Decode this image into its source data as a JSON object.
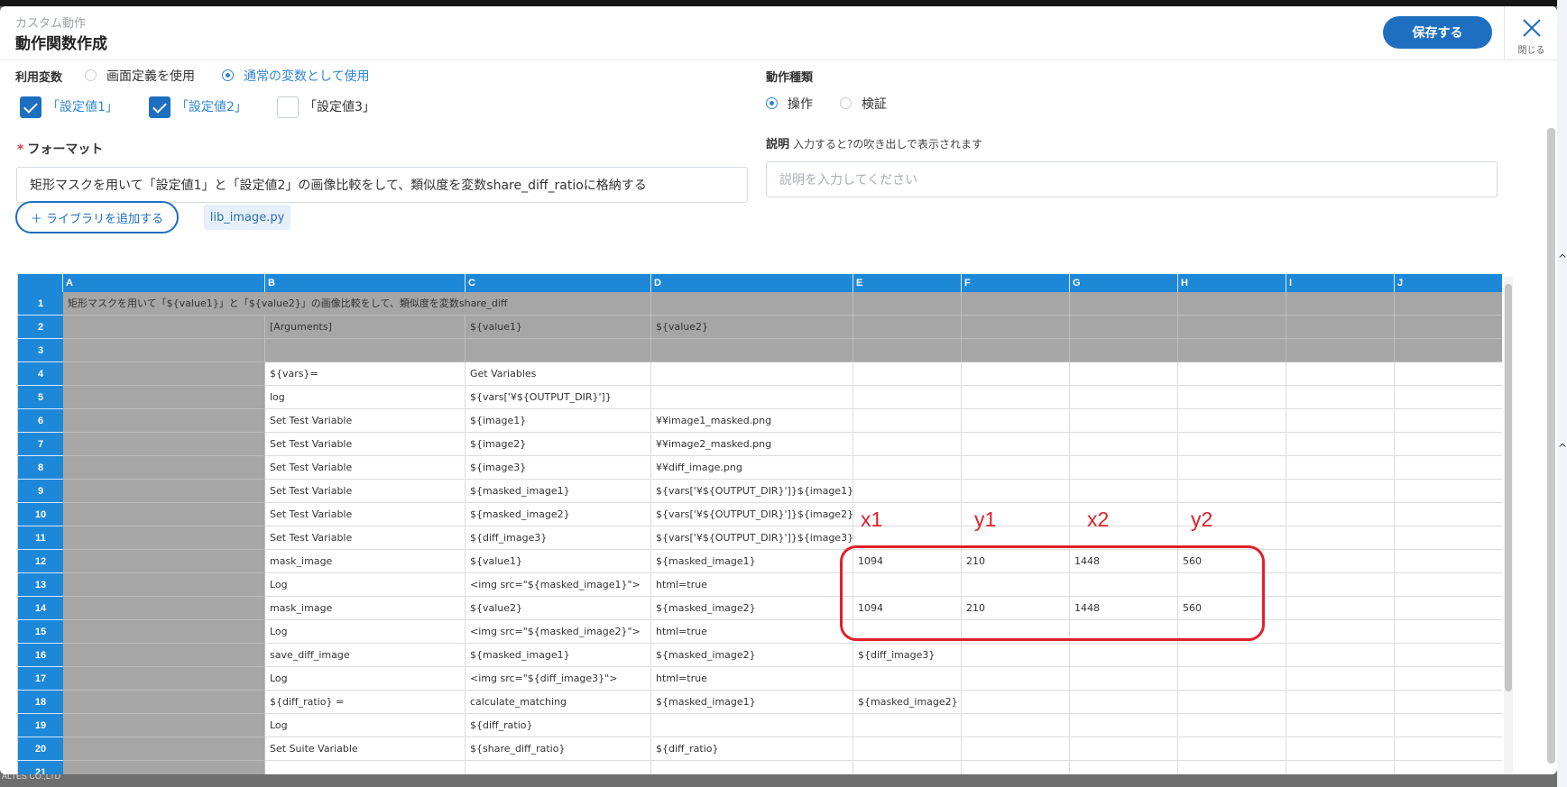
{
  "header": {
    "subtitle": "カスタム動作",
    "title": "動作関数作成",
    "save_label": "保存する",
    "close_label": "閉じる"
  },
  "variables": {
    "label": "利用変数",
    "radio_screen": "画面定義を使用",
    "radio_normal": "通常の変数として使用",
    "checkboxes": [
      "「設定値1」",
      "「設定値2」",
      "「設定値3」"
    ]
  },
  "action_type": {
    "label": "動作種類",
    "op": "操作",
    "verify": "検証"
  },
  "format": {
    "label": "フォーマット",
    "value": "矩形マスクを用いて「設定値1」と「設定値2」の画像比較をして、類似度を変数share_diff_ratioに格納する"
  },
  "description": {
    "label": "説明",
    "hint": "入力すると?の吹き出しで表示されます",
    "placeholder": "説明を入力してください"
  },
  "library": {
    "add_label": "＋ ライブラリを追加する",
    "chip": "lib_image.py"
  },
  "sheet": {
    "columns": [
      "A",
      "B",
      "C",
      "D",
      "E",
      "F",
      "G",
      "H",
      "I",
      "J"
    ],
    "rows": [
      [
        "1",
        "矩形マスクを用いて「${value1}」と「${value2}」の画像比較をして、類似度を変数share_diff",
        "",
        "",
        "",
        "",
        "",
        "",
        "",
        "",
        ""
      ],
      [
        "2",
        "",
        "[Arguments]",
        "${value1}",
        "${value2}",
        "",
        "",
        "",
        "",
        "",
        ""
      ],
      [
        "3",
        "",
        "",
        "",
        "",
        "",
        "",
        "",
        "",
        "",
        ""
      ],
      [
        "4",
        "",
        "${vars}=",
        "Get Variables",
        "",
        "",
        "",
        "",
        "",
        "",
        ""
      ],
      [
        "5",
        "",
        "log",
        "${vars['¥${OUTPUT_DIR}']}",
        "",
        "",
        "",
        "",
        "",
        "",
        ""
      ],
      [
        "6",
        "",
        "Set Test Variable",
        "${image1}",
        "¥¥image1_masked.png",
        "",
        "",
        "",
        "",
        "",
        ""
      ],
      [
        "7",
        "",
        "Set Test Variable",
        "${image2}",
        "¥¥image2_masked.png",
        "",
        "",
        "",
        "",
        "",
        ""
      ],
      [
        "8",
        "",
        "Set Test Variable",
        "${image3}",
        "¥¥diff_image.png",
        "",
        "",
        "",
        "",
        "",
        ""
      ],
      [
        "9",
        "",
        "Set Test Variable",
        "${masked_image1}",
        "${vars['¥${OUTPUT_DIR}']}${image1}",
        "",
        "",
        "",
        "",
        "",
        ""
      ],
      [
        "10",
        "",
        "Set Test Variable",
        "${masked_image2}",
        "${vars['¥${OUTPUT_DIR}']}${image2}",
        "",
        "",
        "",
        "",
        "",
        ""
      ],
      [
        "11",
        "",
        "Set Test Variable",
        "${diff_image3}",
        "${vars['¥${OUTPUT_DIR}']}${image3}",
        "",
        "",
        "",
        "",
        "",
        ""
      ],
      [
        "12",
        "",
        "mask_image",
        "${value1}",
        "${masked_image1}",
        "1094",
        "210",
        "1448",
        "560",
        "",
        ""
      ],
      [
        "13",
        "",
        "Log",
        "<img src=\"${masked_image1}\">",
        "html=true",
        "",
        "",
        "",
        "",
        "",
        ""
      ],
      [
        "14",
        "",
        "mask_image",
        "${value2}",
        "${masked_image2}",
        "1094",
        "210",
        "1448",
        "560",
        "",
        ""
      ],
      [
        "15",
        "",
        "Log",
        "<img src=\"${masked_image2}\">",
        "html=true",
        "",
        "",
        "",
        "",
        "",
        ""
      ],
      [
        "16",
        "",
        "save_diff_image",
        "${masked_image1}",
        "${masked_image2}",
        "${diff_image3}",
        "",
        "",
        "",
        "",
        ""
      ],
      [
        "17",
        "",
        "Log",
        "<img src=\"${diff_image3}\">",
        "html=true",
        "",
        "",
        "",
        "",
        "",
        ""
      ],
      [
        "18",
        "",
        "${diff_ratio} =",
        "calculate_matching",
        "${masked_image1}",
        "${masked_image2}",
        "",
        "",
        "",
        "",
        ""
      ],
      [
        "19",
        "",
        "Log",
        "${diff_ratio}",
        "",
        "",
        "",
        "",
        "",
        "",
        ""
      ],
      [
        "20",
        "",
        "Set Suite Variable",
        "${share_diff_ratio}",
        "${diff_ratio}",
        "",
        "",
        "",
        "",
        "",
        ""
      ],
      [
        "21",
        "",
        "",
        "",
        "",
        "",
        "",
        "",
        "",
        "",
        ""
      ]
    ]
  },
  "annotation": {
    "labels": [
      "x1",
      "y1",
      "x2",
      "y2"
    ]
  },
  "footer_text": "ALTES CO.,LTD",
  "colors": {
    "accent": "#1e6fbf",
    "sheet_header": "#1e88d8",
    "gray_cell": "#a6a6a6",
    "annotation": "#e0202a"
  }
}
